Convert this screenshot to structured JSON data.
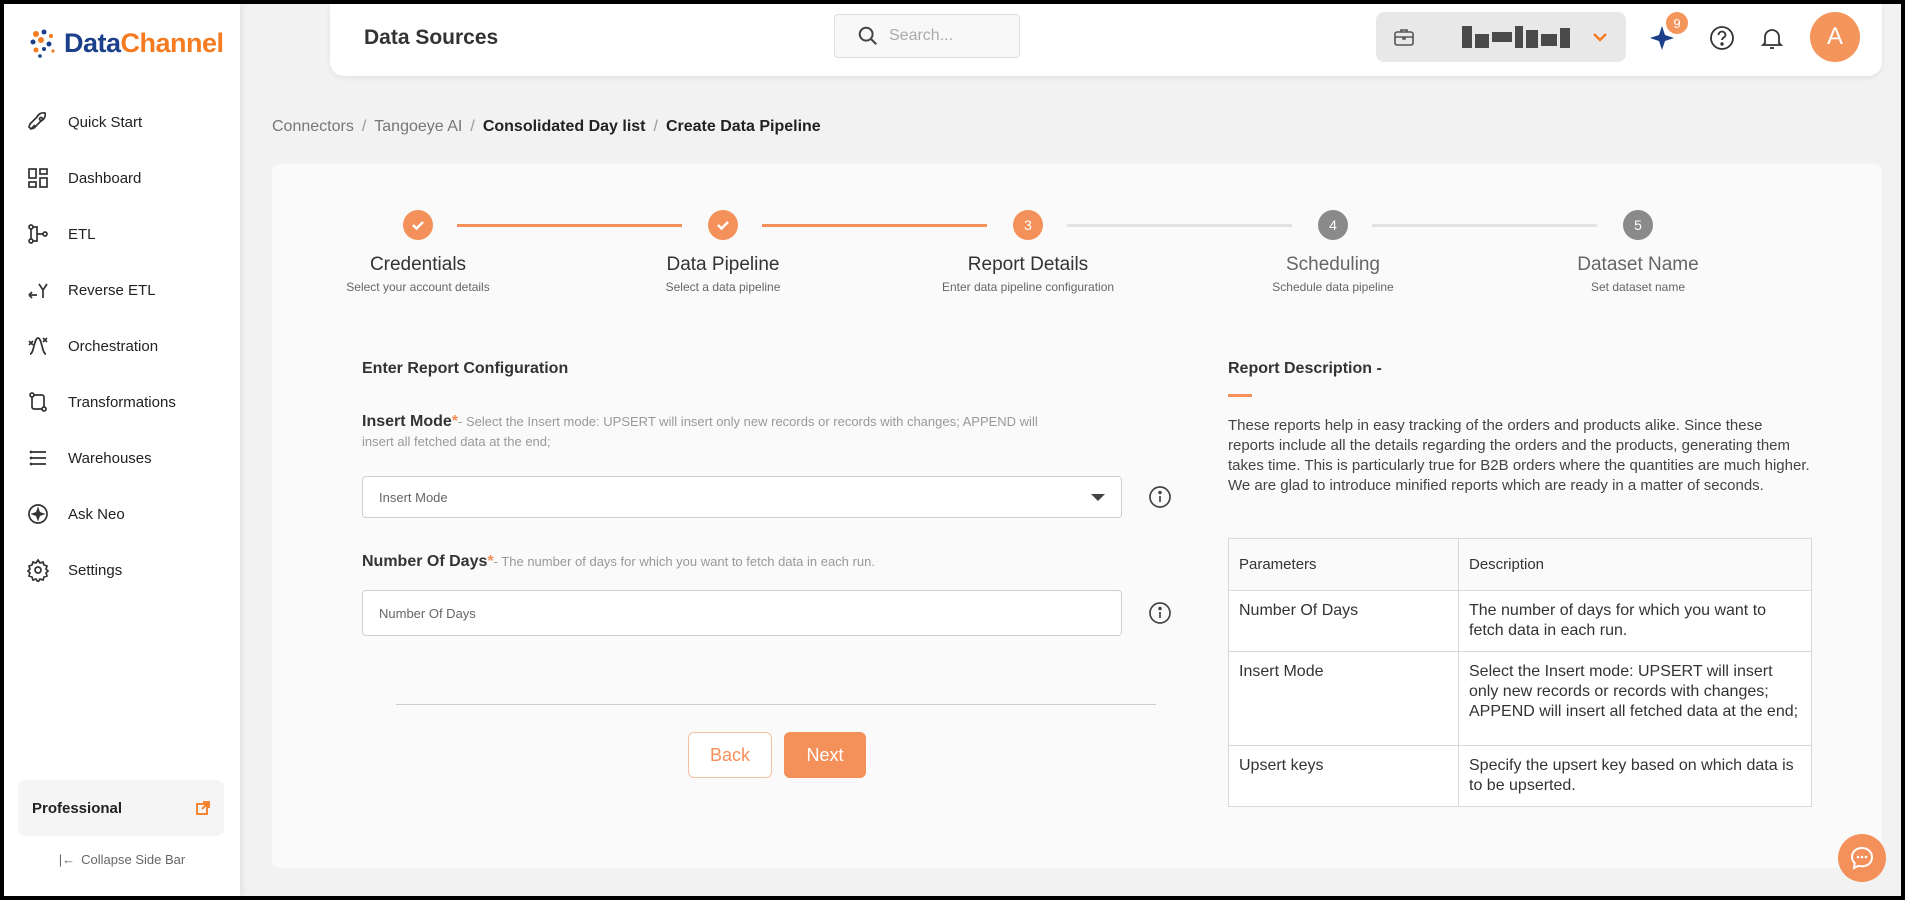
{
  "brand": {
    "name_part1": "Data",
    "name_part2": "Channel",
    "accent": "#f47b20",
    "primary": "#1b3f8b"
  },
  "sidebar": {
    "items": [
      {
        "label": "Quick Start",
        "icon": "rocket-icon"
      },
      {
        "label": "Dashboard",
        "icon": "dashboard-icon"
      },
      {
        "label": "ETL",
        "icon": "etl-icon"
      },
      {
        "label": "Reverse ETL",
        "icon": "reverse-etl-icon"
      },
      {
        "label": "Orchestration",
        "icon": "orchestration-icon"
      },
      {
        "label": "Transformations",
        "icon": "transformations-icon"
      },
      {
        "label": "Warehouses",
        "icon": "warehouse-icon"
      },
      {
        "label": "Ask Neo",
        "icon": "ask-neo-icon"
      },
      {
        "label": "Settings",
        "icon": "gear-icon"
      }
    ],
    "plan_label": "Professional",
    "collapse_label": "Collapse Side Bar"
  },
  "header": {
    "title": "Data Sources",
    "search_placeholder": "Search...",
    "notification_count": "9",
    "avatar_letter": "A"
  },
  "breadcrumb": {
    "items": [
      "Connectors",
      "Tangoeye AI",
      "Consolidated Day list",
      "Create Data Pipeline"
    ]
  },
  "stepper": {
    "steps": [
      {
        "number": "",
        "name": "Credentials",
        "sub": "Select your account details",
        "state": "done"
      },
      {
        "number": "",
        "name": "Data Pipeline",
        "sub": "Select a data pipeline",
        "state": "done"
      },
      {
        "number": "3",
        "name": "Report Details",
        "sub": "Enter data pipeline configuration",
        "state": "active"
      },
      {
        "number": "4",
        "name": "Scheduling",
        "sub": "Schedule data pipeline",
        "state": "todo"
      },
      {
        "number": "5",
        "name": "Dataset Name",
        "sub": "Set dataset name",
        "state": "todo"
      }
    ]
  },
  "form": {
    "title": "Enter Report Configuration",
    "insert_mode": {
      "label": "Insert Mode",
      "required": "*",
      "help": "- Select the Insert mode: UPSERT will insert only new records or records with changes; APPEND will insert all fetched data at the end;",
      "placeholder": "Insert Mode"
    },
    "number_of_days": {
      "label": "Number Of Days",
      "required": "*",
      "help": "- The number of days for which you want to fetch data in each run.",
      "placeholder": "Number Of Days"
    },
    "back_label": "Back",
    "next_label": "Next"
  },
  "description": {
    "title": "Report Description -",
    "text": "These reports help in easy tracking of the orders and products alike. Since these reports include all the details regarding the orders and the products, generating them takes time. This is particularly true for B2B orders where the quantities are much higher. We are glad to introduce minified reports which are ready in a matter of seconds.",
    "table_headers": [
      "Parameters",
      "Description"
    ],
    "rows": [
      [
        "Number Of Days",
        "The number of days for which you want to fetch data in each run."
      ],
      [
        "Insert Mode",
        "Select the Insert mode: UPSERT will insert only new records or records with changes; APPEND will insert all fetched data at the end;"
      ],
      [
        "Upsert keys",
        "Specify the upsert key based on which data is to be upserted."
      ]
    ]
  }
}
